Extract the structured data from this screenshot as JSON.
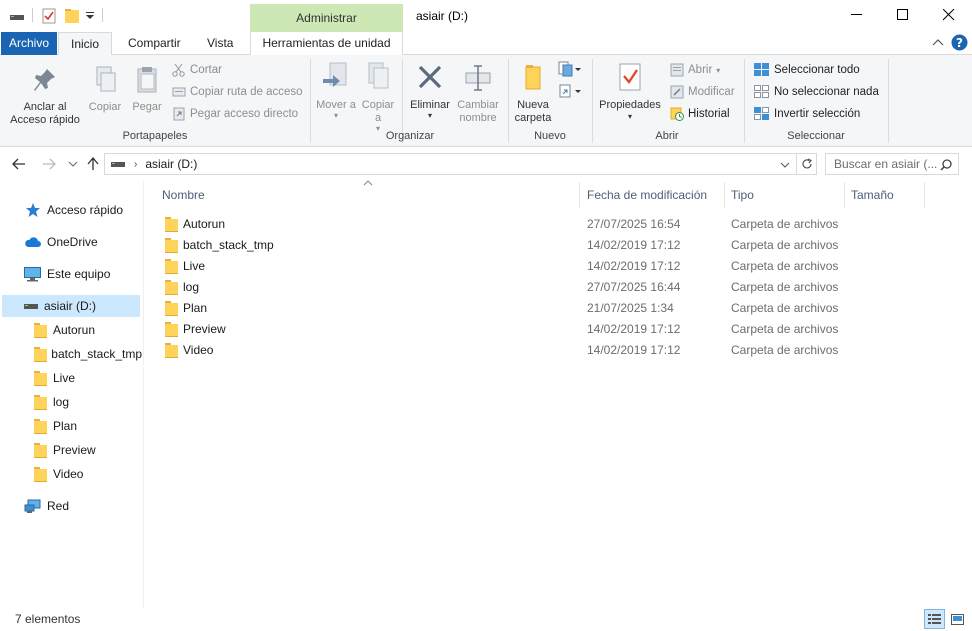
{
  "window": {
    "title": "asiair (D:)",
    "context_tab_header": "Administrar",
    "minimize": "—",
    "maximize": "☐",
    "close": "✕"
  },
  "tabs": {
    "file": "Archivo",
    "home": "Inicio",
    "share": "Compartir",
    "view": "Vista",
    "drive_tools": "Herramientas de unidad"
  },
  "ribbon": {
    "clipboard": {
      "label": "Portapapeles",
      "pin": "Anclar al Acceso rápido",
      "copy": "Copiar",
      "paste": "Pegar",
      "cut": "Cortar",
      "copy_path": "Copiar ruta de acceso",
      "paste_shortcut": "Pegar acceso directo"
    },
    "organize": {
      "label": "Organizar",
      "move_to": "Mover a",
      "copy_to": "Copiar a",
      "delete": "Eliminar",
      "rename": "Cambiar nombre"
    },
    "new": {
      "label": "Nuevo",
      "new_folder": "Nueva carpeta"
    },
    "open": {
      "label": "Abrir",
      "properties": "Propiedades",
      "open": "Abrir",
      "edit": "Modificar",
      "history": "Historial"
    },
    "select": {
      "label": "Seleccionar",
      "select_all": "Seleccionar todo",
      "select_none": "No seleccionar nada",
      "invert": "Invertir selección"
    }
  },
  "address": {
    "path": "asiair (D:)",
    "search_placeholder": "Buscar en asiair (..."
  },
  "nav": {
    "quick_access": "Acceso rápido",
    "onedrive": "OneDrive",
    "this_pc": "Este equipo",
    "drive": "asiair (D:)",
    "children": [
      "Autorun",
      "batch_stack_tmp",
      "Live",
      "log",
      "Plan",
      "Preview",
      "Video"
    ],
    "network": "Red"
  },
  "columns": {
    "name": "Nombre",
    "date": "Fecha de modificación",
    "type": "Tipo",
    "size": "Tamaño"
  },
  "files": [
    {
      "name": "Autorun",
      "date": "27/07/2025 16:54",
      "type": "Carpeta de archivos"
    },
    {
      "name": "batch_stack_tmp",
      "date": "14/02/2019 17:12",
      "type": "Carpeta de archivos"
    },
    {
      "name": "Live",
      "date": "14/02/2019 17:12",
      "type": "Carpeta de archivos"
    },
    {
      "name": "log",
      "date": "27/07/2025 16:44",
      "type": "Carpeta de archivos"
    },
    {
      "name": "Plan",
      "date": "21/07/2025 1:34",
      "type": "Carpeta de archivos"
    },
    {
      "name": "Preview",
      "date": "14/02/2019 17:12",
      "type": "Carpeta de archivos"
    },
    {
      "name": "Video",
      "date": "14/02/2019 17:12",
      "type": "Carpeta de archivos"
    }
  ],
  "status": {
    "count": "7 elementos"
  }
}
